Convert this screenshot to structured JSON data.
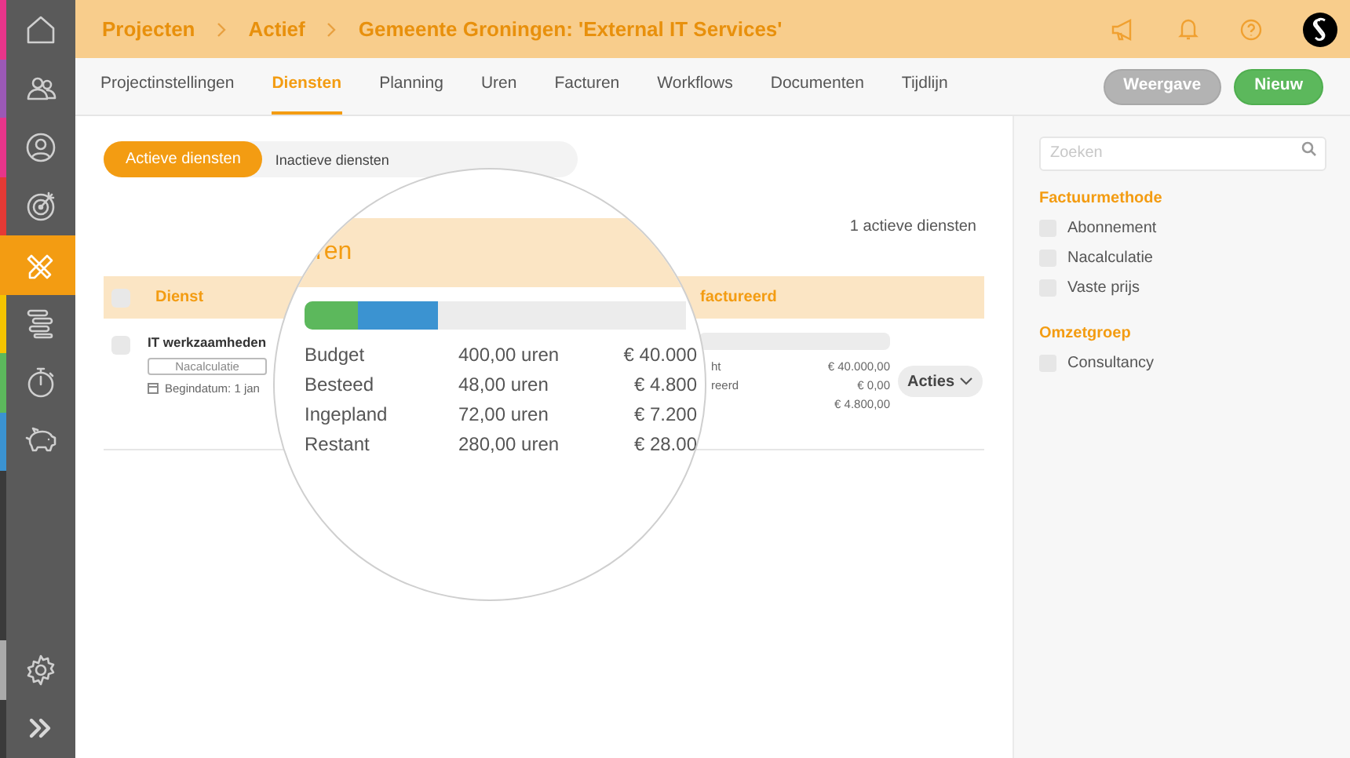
{
  "sidebar": {
    "items": [
      {
        "kind": "home",
        "color": "#e8358a",
        "selected": false
      },
      {
        "kind": "users",
        "color": "#9b59b6",
        "selected": false
      },
      {
        "kind": "user",
        "color": "#e8358a",
        "selected": false
      },
      {
        "kind": "target",
        "color": "#e53935",
        "selected": false
      },
      {
        "kind": "tools",
        "color": "#f39c12",
        "selected": true
      },
      {
        "kind": "gantt",
        "color": "#f5c400",
        "selected": false
      },
      {
        "kind": "stopwatch",
        "color": "#5cb85c",
        "selected": false
      },
      {
        "kind": "piggy",
        "color": "#3b93d1",
        "selected": false
      }
    ],
    "bottom": [
      {
        "kind": "gear",
        "color": "#aaaaaa"
      },
      {
        "kind": "expand",
        "color": "#3a3a3a"
      }
    ]
  },
  "breadcrumb": [
    "Projecten",
    "Actief",
    "Gemeente Groningen: 'External IT Services'"
  ],
  "tabs": [
    {
      "label": "Projectinstellingen",
      "selected": false
    },
    {
      "label": "Diensten",
      "selected": true
    },
    {
      "label": "Planning",
      "selected": false
    },
    {
      "label": "Uren",
      "selected": false
    },
    {
      "label": "Facturen",
      "selected": false
    },
    {
      "label": "Workflows",
      "selected": false
    },
    {
      "label": "Documenten",
      "selected": false
    },
    {
      "label": "Tijdlijn",
      "selected": false
    }
  ],
  "buttons": [
    {
      "label": "Weergave",
      "kind": "secondary"
    },
    {
      "label": "Nieuw",
      "kind": "primary"
    }
  ],
  "filter_tabs": [
    {
      "label": "Actieve diensten",
      "selected": true
    },
    {
      "label": "Inactieve diensten",
      "selected": false
    }
  ],
  "count": "1 actieve diensten",
  "table": {
    "columns": [
      "Dienst",
      "factureerd"
    ],
    "all_checked": false,
    "rows": [
      {
        "checked": false,
        "name": "IT werkzaamheden",
        "tag": "Nacalculatie",
        "start": "Begindatum: 1 jan",
        "level": 0,
        "labels": [
          "ht",
          "reerd"
        ],
        "values": [
          "€ 40.000,00",
          "€ 0,00",
          "€ 4.800,00"
        ],
        "action": "Acties"
      }
    ]
  },
  "magnifier": {
    "title": "ren",
    "bars": [
      {
        "level": 0.12,
        "color": "#5cb85c"
      },
      {
        "level": 0.18,
        "color": "#3b93d1"
      }
    ],
    "rows": [
      {
        "label": "Budget",
        "hours": "400,00 uren",
        "amount": "€ 40.000"
      },
      {
        "label": "Besteed",
        "hours": "48,00 uren",
        "amount": "€ 4.800"
      },
      {
        "label": "Ingepland",
        "hours": "72,00 uren",
        "amount": "€ 7.200"
      },
      {
        "label": "Restant",
        "hours": "280,00 uren",
        "amount": "€ 28.00"
      }
    ]
  },
  "filters": {
    "search": {
      "placeholder": "Zoeken"
    },
    "groups": [
      {
        "title": "Factuurmethode",
        "options": [
          {
            "label": "Abonnement",
            "checked": false
          },
          {
            "label": "Nacalculatie",
            "checked": false
          },
          {
            "label": "Vaste prijs",
            "checked": false
          }
        ]
      },
      {
        "title": "Omzetgroep",
        "options": [
          {
            "label": "Consultancy",
            "checked": false
          }
        ]
      }
    ]
  }
}
